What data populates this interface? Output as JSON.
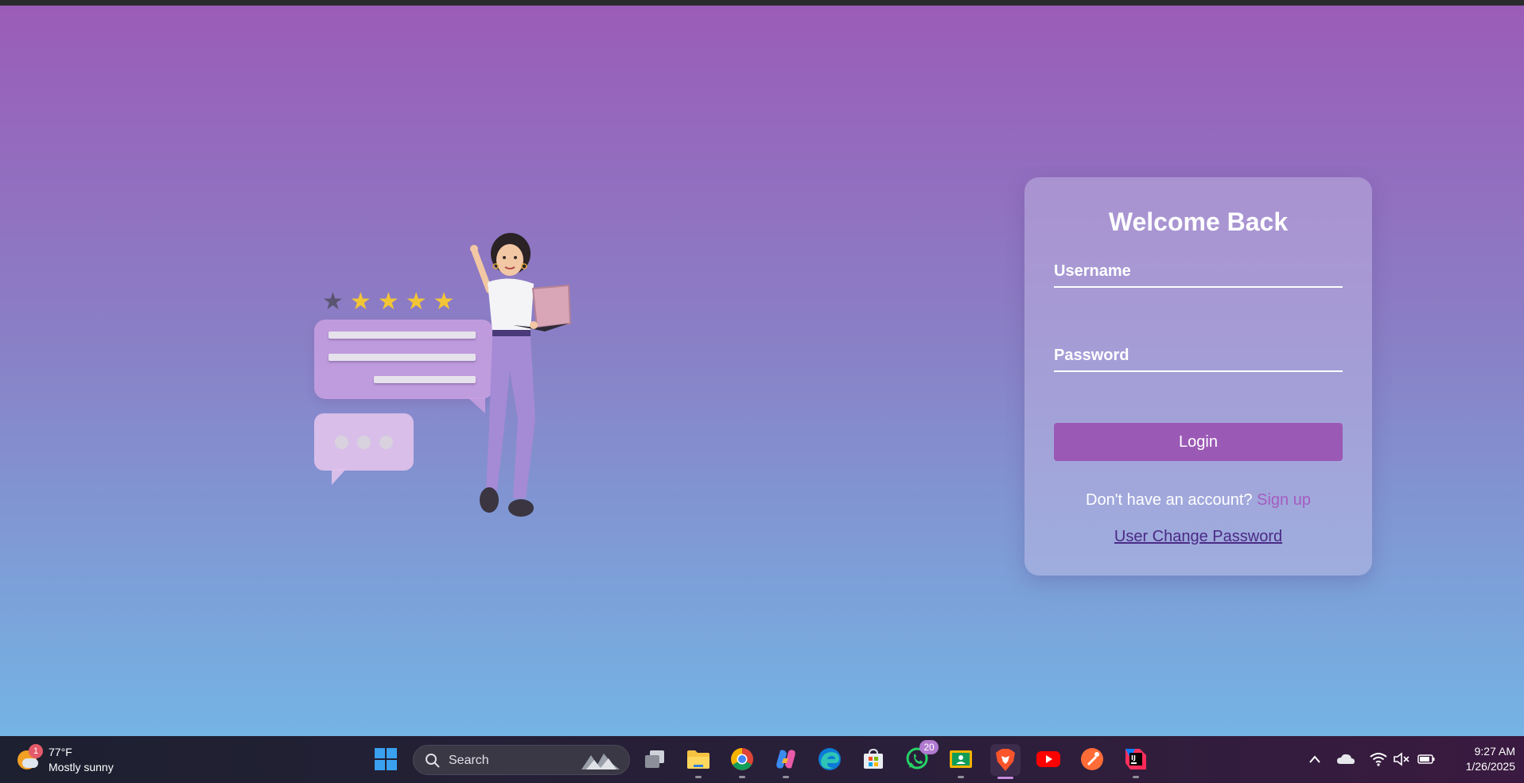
{
  "login": {
    "title": "Welcome Back",
    "username_label": "Username",
    "password_label": "Password",
    "login_button": "Login",
    "no_account_text": "Don't have an account?",
    "signup_link": "Sign up",
    "change_password_link": "User Change Password"
  },
  "illustration": {
    "rating_stars": 4,
    "rating_max": 5
  },
  "taskbar": {
    "weather": {
      "badge": "1",
      "temperature": "77°F",
      "condition": "Mostly sunny"
    },
    "search_placeholder": "Search",
    "apps": [
      {
        "name": "Task View",
        "icon": "task-view-icon"
      },
      {
        "name": "File Explorer",
        "icon": "folder-icon"
      },
      {
        "name": "Chrome",
        "icon": "chrome-icon"
      },
      {
        "name": "Copilot",
        "icon": "copilot-icon"
      },
      {
        "name": "Edge",
        "icon": "edge-icon"
      },
      {
        "name": "Microsoft Store",
        "icon": "store-icon"
      },
      {
        "name": "WhatsApp",
        "icon": "whatsapp-icon",
        "badge": "20"
      },
      {
        "name": "Google Classroom",
        "icon": "classroom-icon"
      },
      {
        "name": "Brave",
        "icon": "brave-icon",
        "active": true
      },
      {
        "name": "YouTube",
        "icon": "youtube-icon"
      },
      {
        "name": "Postman",
        "icon": "postman-icon"
      },
      {
        "name": "IntelliJ IDEA",
        "icon": "intellij-icon"
      }
    ],
    "clock": {
      "time": "9:27 AM",
      "date": "1/26/2025"
    }
  },
  "colors": {
    "gradient_top": "#9b5cb8",
    "gradient_bottom": "#74b4e4",
    "button": "#9b59b6",
    "signup_link": "#a55cc0",
    "change_password_link": "#4a2a86"
  }
}
